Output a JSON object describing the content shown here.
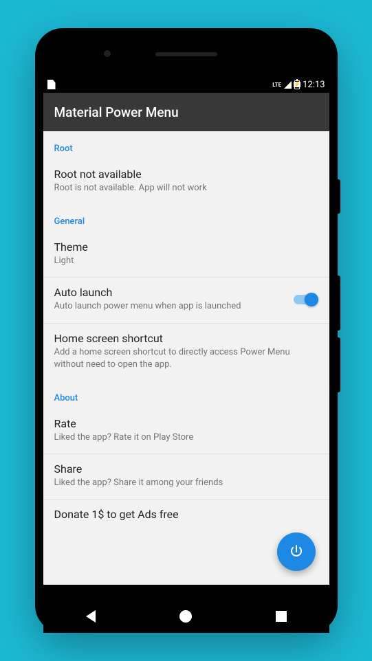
{
  "status": {
    "network": "LTE",
    "time": "12:13"
  },
  "app": {
    "title": "Material Power Menu"
  },
  "sections": {
    "root": {
      "header": "Root",
      "status_title": "Root not available",
      "status_subtitle": "Root is not available. App will not work"
    },
    "general": {
      "header": "General",
      "theme_title": "Theme",
      "theme_value": "Light",
      "autolaunch_title": "Auto launch",
      "autolaunch_subtitle": "Auto launch power menu when app is launched",
      "shortcut_title": "Home screen shortcut",
      "shortcut_subtitle": "Add a home screen shortcut to directly access Power Menu without need to open the app."
    },
    "about": {
      "header": "About",
      "rate_title": "Rate",
      "rate_subtitle": "Liked the app? Rate it on Play Store",
      "share_title": "Share",
      "share_subtitle": "Liked the app? Share it among your friends",
      "donate_title": "Donate 1$ to get Ads free"
    }
  },
  "colors": {
    "accent": "#1e88e5",
    "background": "#1db8d4"
  }
}
